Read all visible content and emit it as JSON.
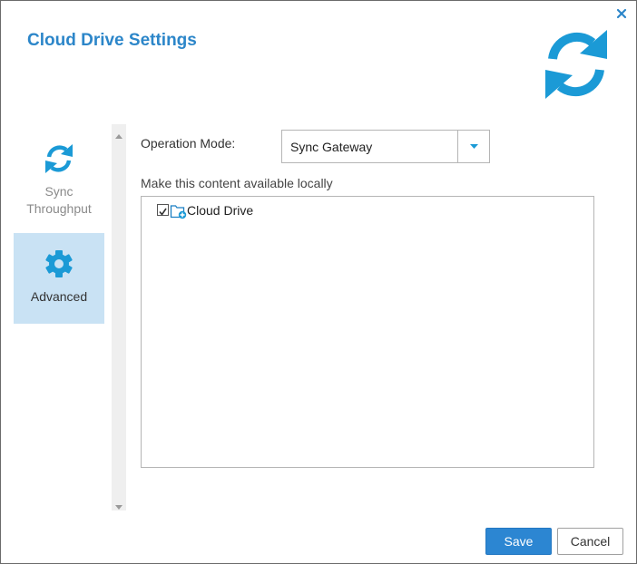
{
  "dialog": {
    "title": "Cloud Drive Settings",
    "close_icon": "close-icon",
    "header_icon": "sync-icon",
    "accent_color": "#2c86c9"
  },
  "sidebar": {
    "items": [
      {
        "label_line1": "Sync",
        "label_line2": "Throughput",
        "icon": "sync-icon",
        "active": false
      },
      {
        "label": "Advanced",
        "icon": "gear-icon",
        "active": true
      }
    ]
  },
  "form": {
    "operation_mode_label": "Operation Mode:",
    "operation_mode_value": "Sync Gateway",
    "content_label": "Make this content available locally",
    "tree": [
      {
        "label": "Cloud Drive",
        "checked": true,
        "icon": "cloud-folder-icon"
      }
    ]
  },
  "buttons": {
    "save": "Save",
    "cancel": "Cancel"
  }
}
